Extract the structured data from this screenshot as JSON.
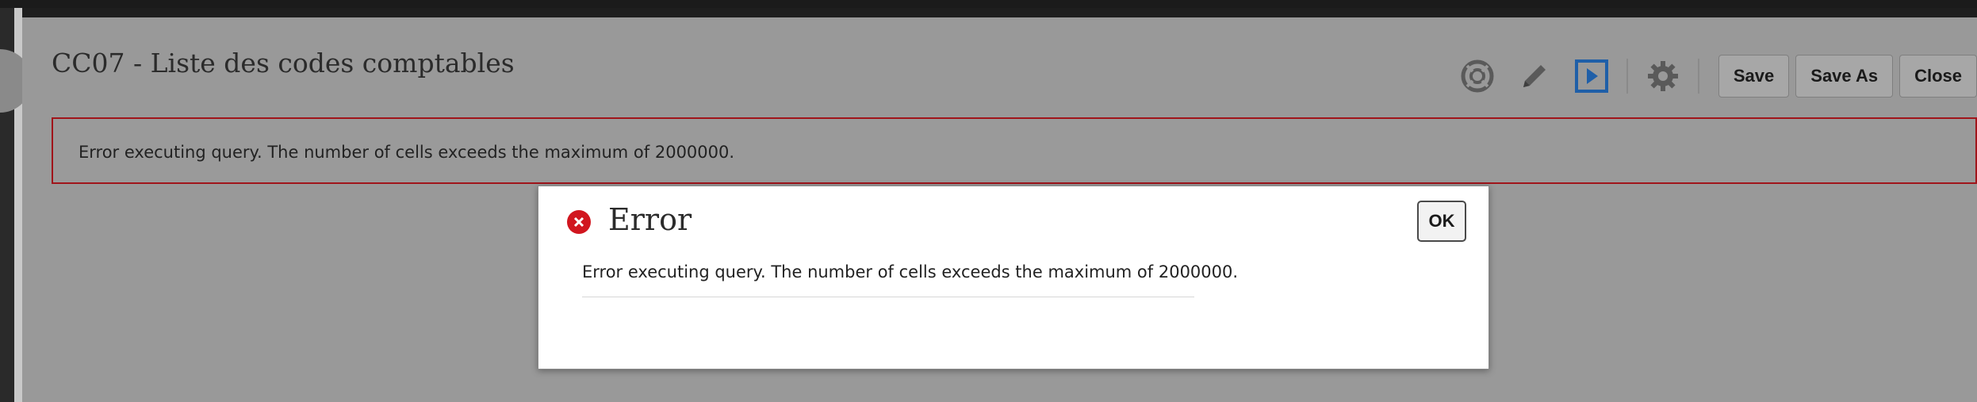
{
  "page": {
    "title": "CC07 - Liste des codes comptables"
  },
  "toolbar": {
    "icons": [
      "lifebuoy-icon",
      "pencil-icon",
      "play-icon",
      "gear-icon"
    ],
    "save_label": "Save",
    "save_as_label": "Save As",
    "close_label": "Close"
  },
  "error_banner": {
    "message": "Error executing query. The number of cells exceeds the maximum of 2000000."
  },
  "dialog": {
    "title": "Error",
    "ok_label": "OK",
    "message": "Error executing query. The number of cells exceeds the maximum of 2000000."
  },
  "colors": {
    "error_red": "#d1161f",
    "banner_border": "#a0141a",
    "play_blue": "#1f5fa8",
    "overlay_gray": "#999999"
  }
}
